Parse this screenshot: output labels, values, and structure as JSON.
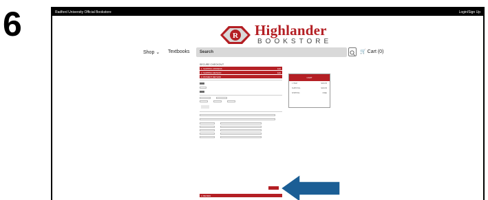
{
  "step": {
    "number": "6"
  },
  "topbar": {
    "site_name": "Radford University Official Bookstore",
    "login": "Login/Sign Up"
  },
  "logo": {
    "brand": "Highlander",
    "sub": "BOOKSTORE",
    "seal_text": "R"
  },
  "nav": {
    "shop": "Shop",
    "textbooks": "Textbooks",
    "search_placeholder": "Search",
    "cart": "Cart (0)"
  },
  "checkout": {
    "title": "SECURE CHECKOUT",
    "sections": [
      {
        "label": "1. SHIPPING ADDRESS",
        "action": "Edit"
      },
      {
        "label": "2. SHIPPING METHOD",
        "action": "Edit"
      },
      {
        "label": "3. PAYMENT METHOD",
        "action": ""
      }
    ],
    "review_label": "4. REVIEW"
  },
  "cart_summary": {
    "title": "CART",
    "item_line": "1 ITEM",
    "item_value": "$163.95",
    "subtotal_label": "SUBTOTAL",
    "subtotal_value": "$163.95",
    "shipping_label": "SHIPPING",
    "shipping_value": "FREE"
  },
  "colors": {
    "brand_red": "#b41f24",
    "arrow_blue": "#1b5e95"
  }
}
